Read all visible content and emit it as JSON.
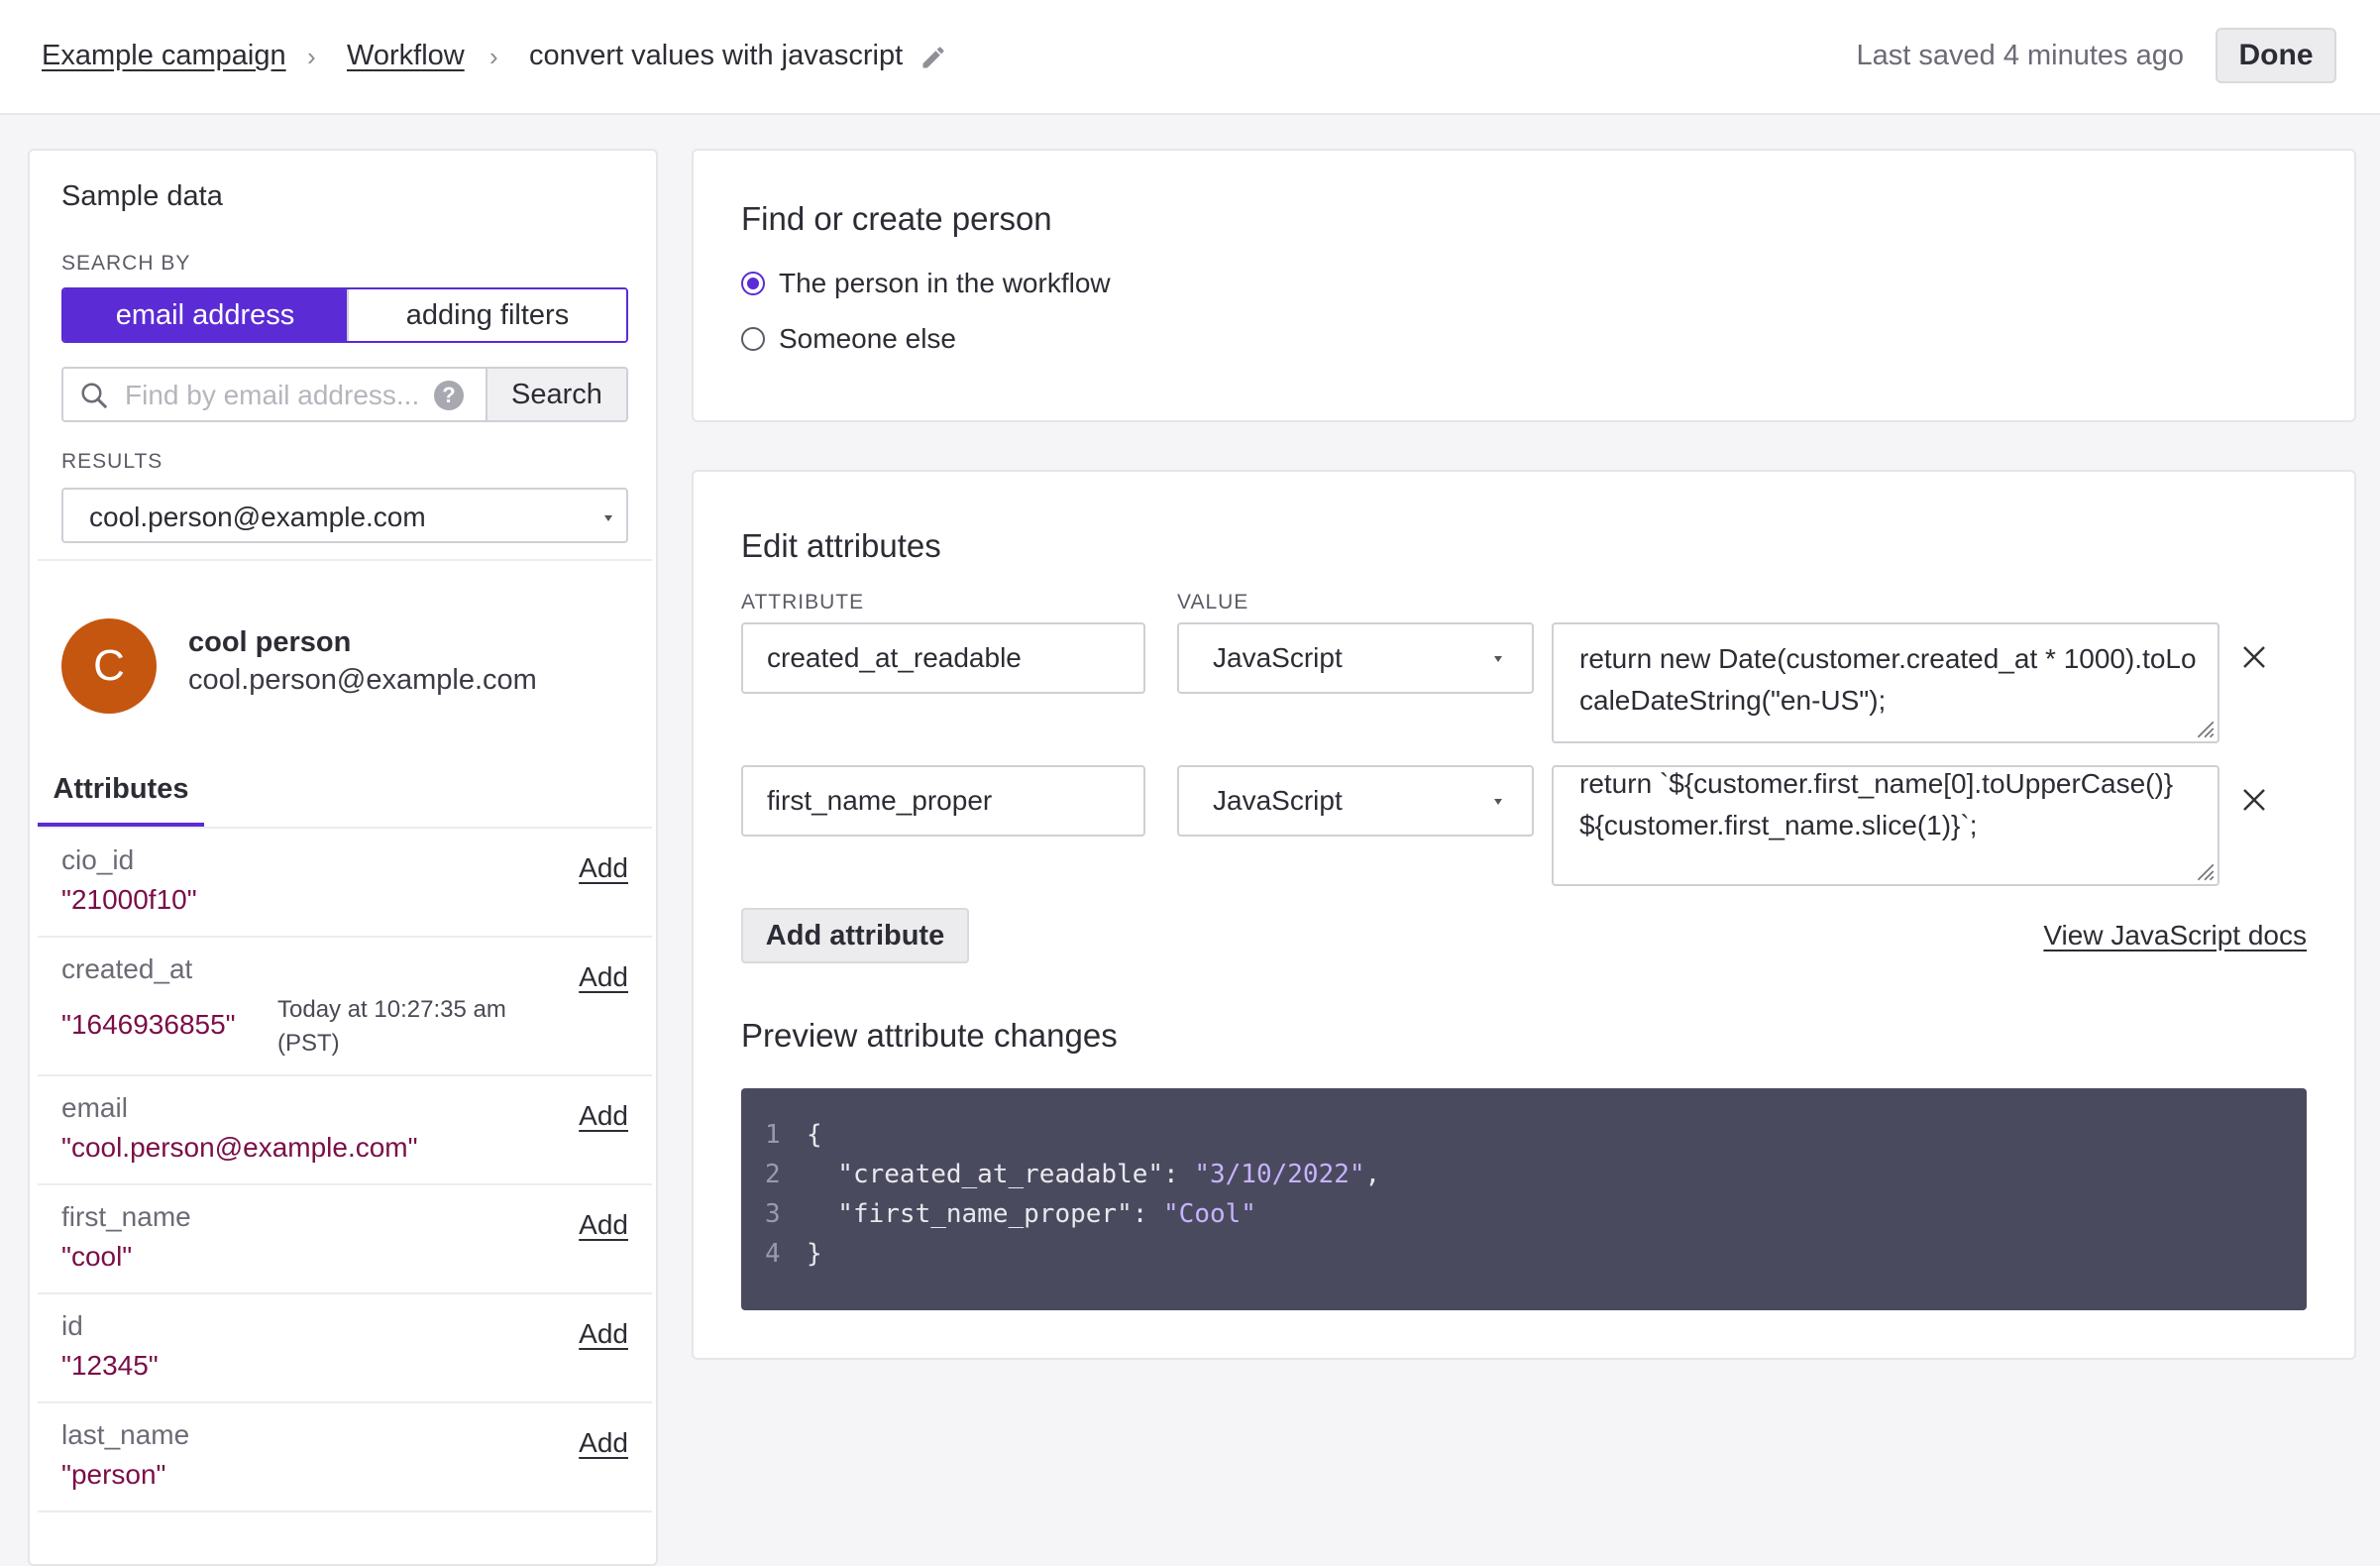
{
  "breadcrumb": {
    "items": [
      "Example campaign",
      "Workflow"
    ],
    "separator": "›",
    "current": "convert values with javascript"
  },
  "header": {
    "saved_text": "Last saved 4 minutes ago",
    "done_label": "Done"
  },
  "sample": {
    "title": "Sample data",
    "search_by_label": "SEARCH BY",
    "segments": [
      "email address",
      "adding filters"
    ],
    "search_placeholder": "Find by email address...",
    "help_glyph": "?",
    "search_button": "Search",
    "results_label": "RESULTS",
    "results_selected": "cool.person@example.com"
  },
  "person": {
    "initial": "C",
    "name": "cool person",
    "email": "cool.person@example.com",
    "tab": "Attributes",
    "add_label": "Add",
    "attributes": [
      {
        "key": "cio_id",
        "value": "\"21000f10\""
      },
      {
        "key": "created_at",
        "value": "\"1646936855\"",
        "note": "Today at 10:27:35 am (PST)"
      },
      {
        "key": "email",
        "value": "\"cool.person@example.com\""
      },
      {
        "key": "first_name",
        "value": "\"cool\""
      },
      {
        "key": "id",
        "value": "\"12345\""
      },
      {
        "key": "last_name",
        "value": "\"person\""
      }
    ]
  },
  "find_person": {
    "title": "Find or create person",
    "options": [
      "The person in the workflow",
      "Someone else"
    ],
    "selected_index": 0
  },
  "edit": {
    "title": "Edit attributes",
    "attribute_label": "ATTRIBUTE",
    "value_label": "VALUE",
    "rows": [
      {
        "attribute": "created_at_readable",
        "type": "JavaScript",
        "code": "return new Date(customer.created_at * 1000).toLocaleDateString(\"en-US\");"
      },
      {
        "attribute": "first_name_proper",
        "type": "JavaScript",
        "code": "return `${customer.first_name[0].toUpperCase()}${customer.first_name.slice(1)}`;"
      }
    ],
    "add_button": "Add attribute",
    "docs_link": "View JavaScript docs"
  },
  "preview": {
    "title": "Preview attribute changes",
    "lines": [
      {
        "n": "1",
        "text": "{"
      },
      {
        "n": "2",
        "key": "  \"created_at_readable\": ",
        "value": "\"3/10/2022\"",
        "tail": ","
      },
      {
        "n": "3",
        "key": "  \"first_name_proper\": ",
        "value": "\"Cool\"",
        "tail": ""
      },
      {
        "n": "4",
        "text": "}"
      }
    ]
  },
  "colors": {
    "accent": "#5b2bd5",
    "value_text": "#7a0e47",
    "avatar": "#c5560f",
    "code_bg": "#4a4a5e"
  }
}
